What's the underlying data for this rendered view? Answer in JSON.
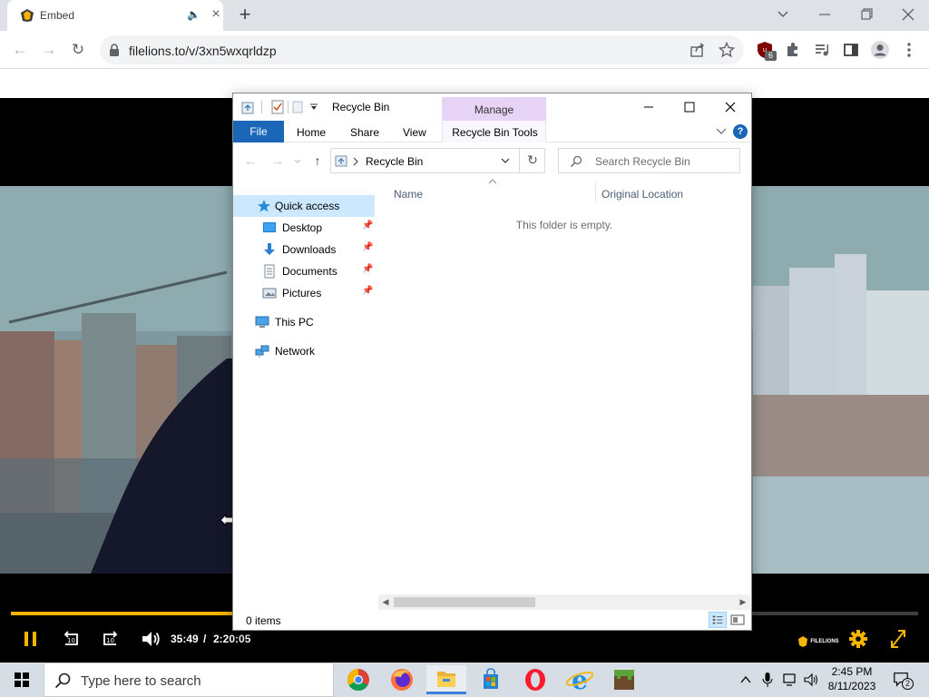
{
  "browser": {
    "tab_title": "Embed",
    "url": "filelions.to/v/3xn5wxqrldzp",
    "extension_badge": "6"
  },
  "player": {
    "current_time": "35:49",
    "separator": "/",
    "duration": "2:20:05",
    "progress_fraction": 0.256,
    "brand": "FILELIONS",
    "accent_color": "#f5b400"
  },
  "explorer": {
    "title": "Recycle Bin",
    "manage_label": "Manage",
    "ribbon_tabs": {
      "file": "File",
      "home": "Home",
      "share": "Share",
      "view": "View",
      "tools": "Recycle Bin Tools"
    },
    "address": "Recycle Bin",
    "search_placeholder": "Search Recycle Bin",
    "nav": {
      "quick_access": "Quick access",
      "desktop": "Desktop",
      "downloads": "Downloads",
      "documents": "Documents",
      "pictures": "Pictures",
      "this_pc": "This PC",
      "network": "Network"
    },
    "columns": {
      "name": "Name",
      "original_location": "Original Location"
    },
    "empty_message": "This folder is empty.",
    "status": "0 items"
  },
  "taskbar": {
    "search_placeholder": "Type here to search",
    "time": "2:45 PM",
    "date": "8/11/2023",
    "notifications": "2"
  }
}
